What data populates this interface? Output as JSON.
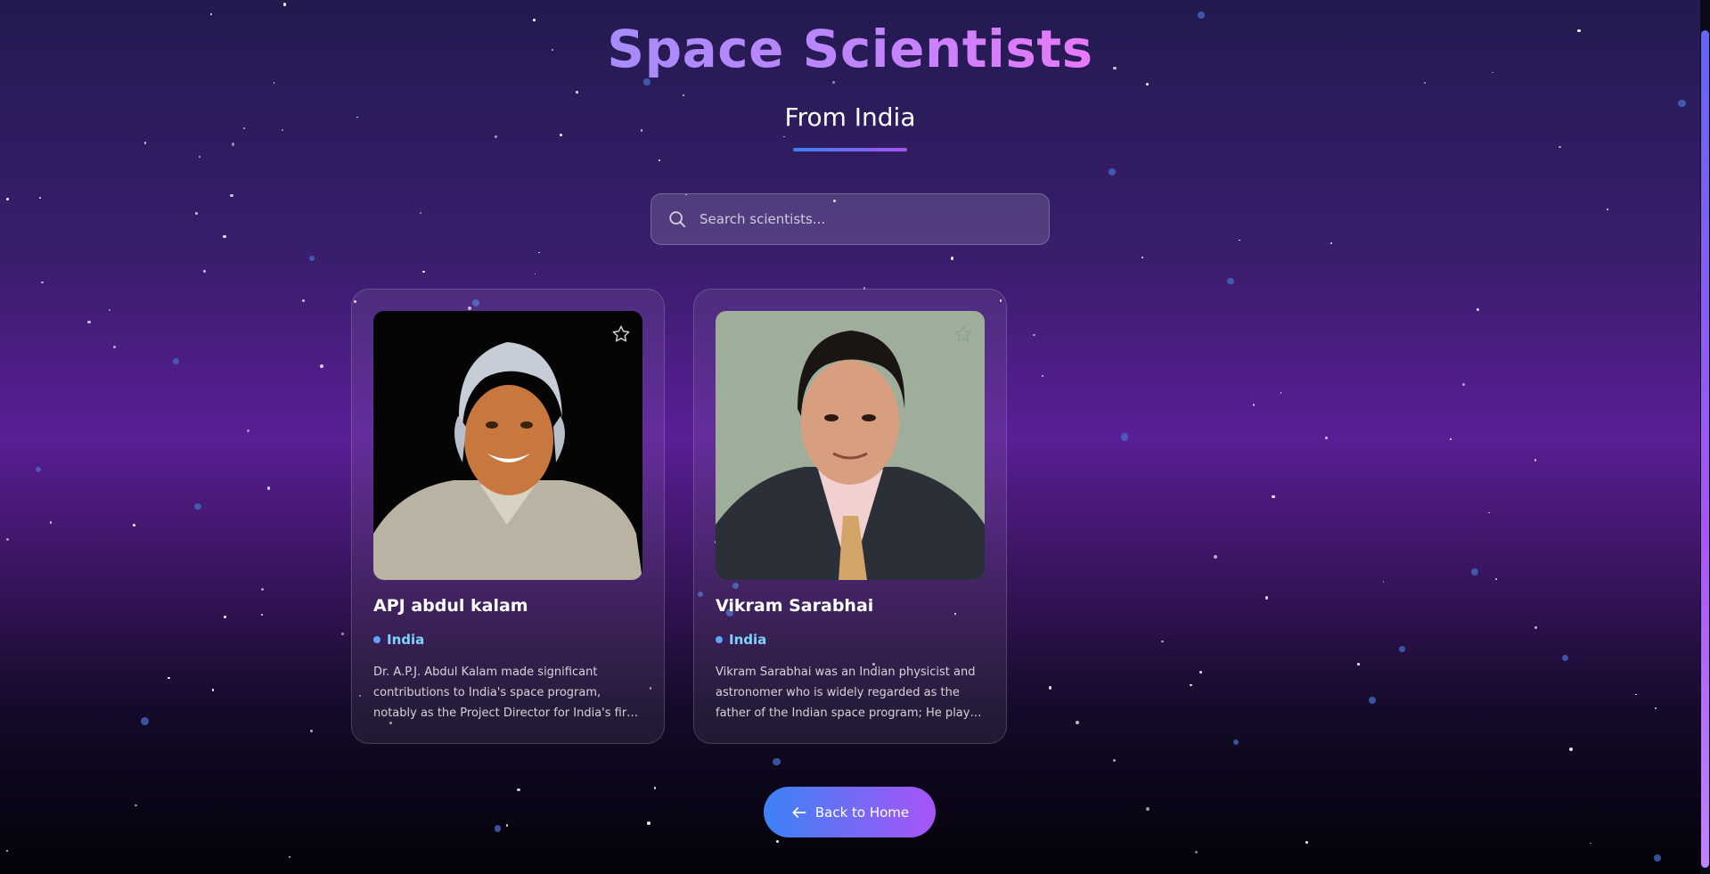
{
  "page": {
    "title": "Space Scientists",
    "subtitle": "From India"
  },
  "search": {
    "placeholder": "Search scientists...",
    "value": ""
  },
  "scientists": [
    {
      "name": "APJ abdul kalam",
      "country": "India",
      "description": "Dr. A.P.J. Abdul Kalam made significant contributions to India's space program, notably as the Project Director for India's first indigenous satellite launch vehicle.",
      "favorite": false
    },
    {
      "name": "Vikram Sarabhai",
      "country": "India",
      "description": "Vikram Sarabhai was an Indian physicist and astronomer who is widely regarded as the father of the Indian space program; He played a pivotal role in establishing space research in India.",
      "favorite": false
    }
  ],
  "actions": {
    "back_label": "Back to Home"
  },
  "icons": {
    "search": "search-icon",
    "favorite": "star-outline-icon",
    "back": "arrow-left-icon"
  },
  "colors": {
    "accent_blue": "#3b82f6",
    "accent_purple": "#a855f7",
    "country_text": "#7dd3fc"
  }
}
